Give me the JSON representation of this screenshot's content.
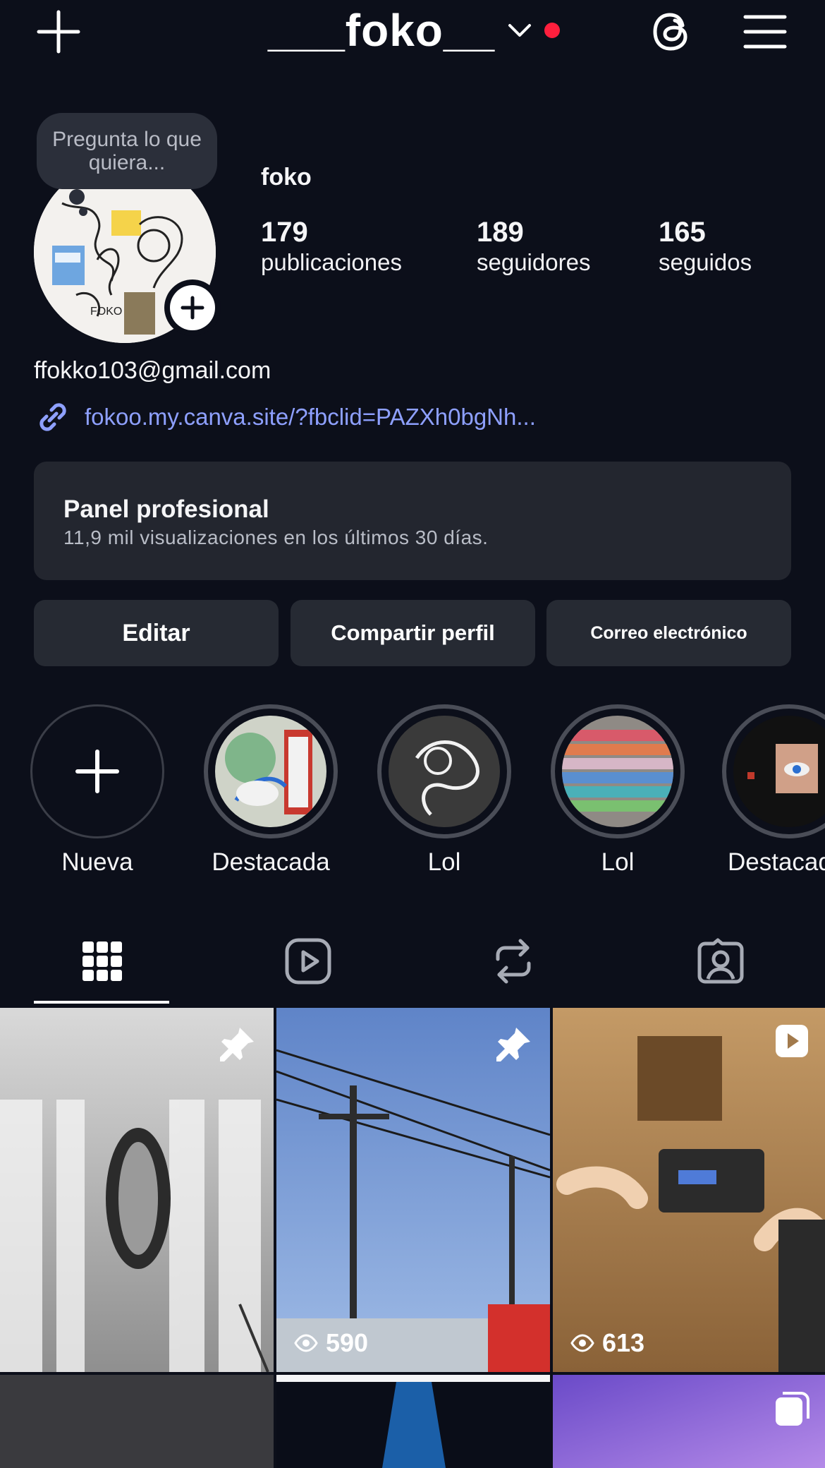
{
  "topbar": {
    "create_icon": "plus-icon",
    "username": "___foko__",
    "switch_icon": "chevron-down-icon",
    "threads_icon": "threads-icon",
    "menu_icon": "hamburger-menu-icon"
  },
  "profile": {
    "note_placeholder": "Pregunta lo que quiera...",
    "avatar_text": "FOKO",
    "display_name": "foko",
    "stats": [
      {
        "value": "179",
        "label": "publicaciones"
      },
      {
        "value": "189",
        "label": "seguidores"
      },
      {
        "value": "165",
        "label": "seguidos"
      }
    ],
    "email": "ffokko103@gmail.com",
    "link": "fokoo.my.canva.site/?fbclid=PAZXh0bgNh..."
  },
  "panel": {
    "title": "Panel profesional",
    "subtitle": "11,9 mil visualizaciones en los últimos 30 días."
  },
  "actions": {
    "edit": "Editar",
    "share": "Compartir perfil",
    "email": "Correo electrónico"
  },
  "highlights": [
    {
      "label": "Nueva"
    },
    {
      "label": "Destacada"
    },
    {
      "label": "Lol"
    },
    {
      "label": "Lol"
    },
    {
      "label": "Destacada"
    }
  ],
  "tabs": [
    "grid-icon",
    "reels-icon",
    "reposts-icon",
    "tagged-icon"
  ],
  "posts": [
    {
      "type": "pinned",
      "views": ""
    },
    {
      "type": "pinned",
      "views": "590"
    },
    {
      "type": "reel",
      "views": "613"
    },
    {
      "type": "post",
      "views": ""
    },
    {
      "type": "post",
      "views": ""
    },
    {
      "type": "carousel",
      "views": ""
    }
  ],
  "colors": {
    "background": "#0c0f1a",
    "card": "#23262f",
    "link": "#8ea0ff",
    "notification_dot": "#ff1f3d"
  }
}
